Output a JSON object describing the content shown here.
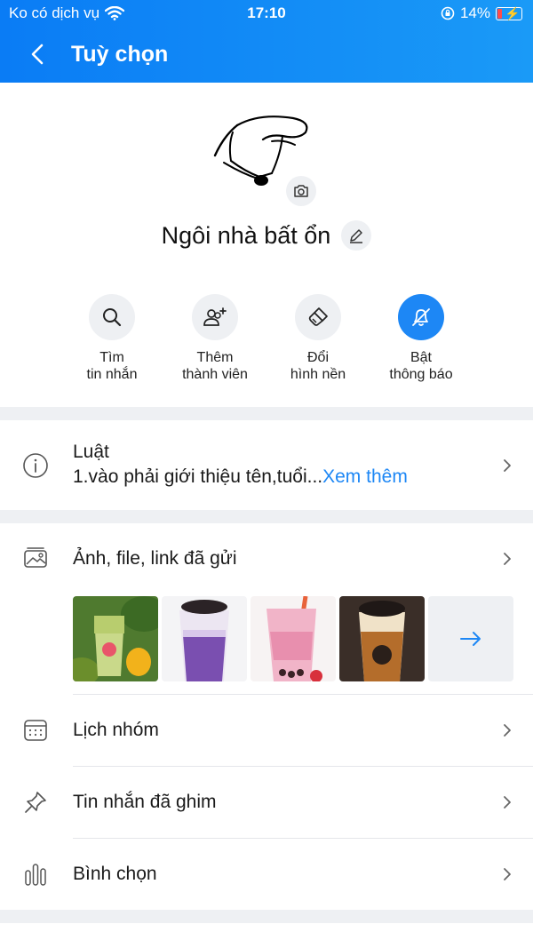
{
  "status": {
    "carrier": "Ko có dịch vụ",
    "time": "17:10",
    "battery": "14%"
  },
  "header": {
    "title": "Tuỳ chọn"
  },
  "profile": {
    "group_name": "Ngôi nhà bất ổn"
  },
  "actions": [
    {
      "line1": "Tìm",
      "line2": "tin nhắn",
      "icon": "search-icon"
    },
    {
      "line1": "Thêm",
      "line2": "thành viên",
      "icon": "add-member-icon"
    },
    {
      "line1": "Đổi",
      "line2": "hình nền",
      "icon": "paint-icon"
    },
    {
      "line1": "Bật",
      "line2": "thông báo",
      "icon": "bell-off-icon"
    }
  ],
  "rules": {
    "title": "Luật",
    "text": "1.vào phải giới thiệu tên,tuổi...",
    "more": "Xem thêm"
  },
  "media": {
    "label": "Ảnh, file, link đã gửi"
  },
  "menu": {
    "calendar": "Lịch nhóm",
    "pinned": "Tin nhắn đã ghim",
    "poll": "Bình chọn"
  },
  "colors": {
    "accent": "#1d87f5",
    "header_start": "#0a7cf5",
    "header_end": "#1a9af7",
    "divider": "#eef0f3"
  }
}
